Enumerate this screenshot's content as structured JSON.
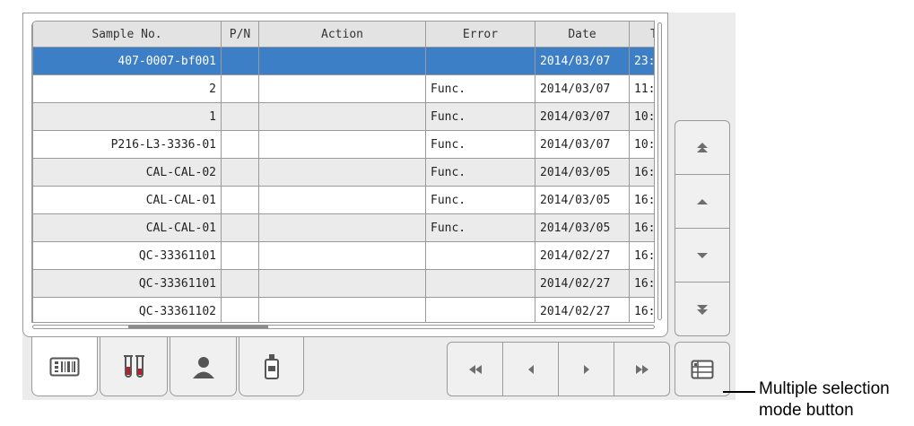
{
  "table": {
    "columns": [
      "Sample No.",
      "P/N",
      "Action",
      "Error",
      "Date",
      "T"
    ],
    "rows": [
      {
        "sample_no": "407-0007-bf001",
        "pn": "",
        "action": "",
        "error": "",
        "date": "2014/03/07",
        "time": "23:",
        "selected": true
      },
      {
        "sample_no": "2",
        "pn": "",
        "action": "",
        "error": "Func.",
        "date": "2014/03/07",
        "time": "11:"
      },
      {
        "sample_no": "1",
        "pn": "",
        "action": "",
        "error": "Func.",
        "date": "2014/03/07",
        "time": "10:"
      },
      {
        "sample_no": "P216-L3-3336-01",
        "pn": "",
        "action": "",
        "error": "Func.",
        "date": "2014/03/07",
        "time": "10:"
      },
      {
        "sample_no": "CAL-CAL-02",
        "pn": "",
        "action": "",
        "error": "Func.",
        "date": "2014/03/05",
        "time": "16:"
      },
      {
        "sample_no": "CAL-CAL-01",
        "pn": "",
        "action": "",
        "error": "Func.",
        "date": "2014/03/05",
        "time": "16:"
      },
      {
        "sample_no": "CAL-CAL-01",
        "pn": "",
        "action": "",
        "error": "Func.",
        "date": "2014/03/05",
        "time": "16:"
      },
      {
        "sample_no": "QC-33361101",
        "pn": "",
        "action": "",
        "error": "",
        "date": "2014/02/27",
        "time": "16:"
      },
      {
        "sample_no": "QC-33361101",
        "pn": "",
        "action": "",
        "error": "",
        "date": "2014/02/27",
        "time": "16:"
      },
      {
        "sample_no": "QC-33361102",
        "pn": "",
        "action": "",
        "error": "",
        "date": "2014/02/27",
        "time": "16:"
      }
    ]
  },
  "side_buttons": [
    {
      "name": "scroll-top-button",
      "icon": "double-up-arrow-icon"
    },
    {
      "name": "scroll-up-button",
      "icon": "up-arrow-icon"
    },
    {
      "name": "scroll-down-button",
      "icon": "down-arrow-icon"
    },
    {
      "name": "scroll-bottom-button",
      "icon": "double-down-arrow-icon"
    }
  ],
  "tabs": [
    {
      "name": "tab-sample-list",
      "icon": "barcode-card-icon",
      "active": true
    },
    {
      "name": "tab-specimen",
      "icon": "test-tubes-icon"
    },
    {
      "name": "tab-patient",
      "icon": "person-icon"
    },
    {
      "name": "tab-reagent",
      "icon": "bottle-icon"
    }
  ],
  "page_nav": [
    {
      "name": "first-page-button",
      "icon": "double-left-arrow-icon"
    },
    {
      "name": "previous-page-button",
      "icon": "left-arrow-icon"
    },
    {
      "name": "next-page-button",
      "icon": "right-arrow-icon"
    },
    {
      "name": "last-page-button",
      "icon": "double-right-arrow-icon"
    }
  ],
  "multi_select": {
    "icon": "list-icon"
  },
  "callout": {
    "line1": "Multiple selection",
    "line2": "mode button"
  },
  "colors": {
    "selected_row": "#3c7fc6",
    "alt_row": "#ebebeb",
    "icon_gray": "#6e6e6e",
    "tube_red": "#b3202a"
  }
}
